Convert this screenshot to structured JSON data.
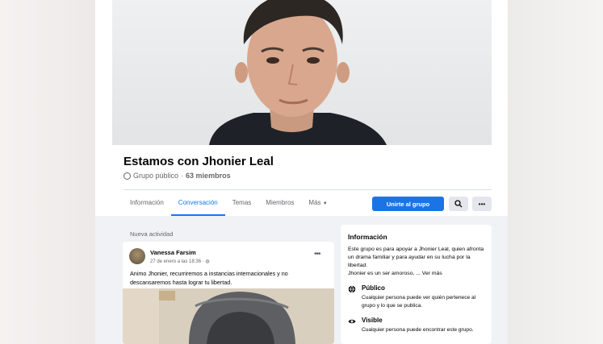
{
  "group": {
    "name": "Estamos con Jhonier Leal",
    "privacy": "Grupo público",
    "members": "63 miembros"
  },
  "tabs": [
    {
      "label": "Información"
    },
    {
      "label": "Conversación"
    },
    {
      "label": "Temas"
    },
    {
      "label": "Miembros"
    },
    {
      "label": "Más",
      "icon": "caret-down-icon"
    }
  ],
  "actions": {
    "join_label": "Unirte al grupo",
    "search_icon": "search-icon",
    "more_icon": "more-dots-icon"
  },
  "feed": {
    "section_label": "Nueva actividad",
    "post": {
      "author": "Vanessa Farsim",
      "time": "27 de enero a las 18:36 ·",
      "text": "Animo Jhonier, recurriremos a instancias internacionales y no descansaremos hasta lograr tu libertad."
    }
  },
  "info": {
    "title": "Información",
    "description": "Este grupo es para apoyar a Jhonier Leal, quien afronta un drama familiar y para ayudar en su lucha por la libertad.",
    "description_more": "Jhonier es un ser amoroso, ... Ver más",
    "public_title": "Público",
    "public_text": "Cualquier persona puede ver quién pertenece al grupo y lo que se publica.",
    "visible_title": "Visible",
    "visible_text": "Cualquier persona puede encontrar este grupo."
  },
  "colors": {
    "accent": "#1877f2",
    "button": "#1b74e4",
    "muted_text": "#65676b",
    "page_bg": "#f0f2f5"
  }
}
